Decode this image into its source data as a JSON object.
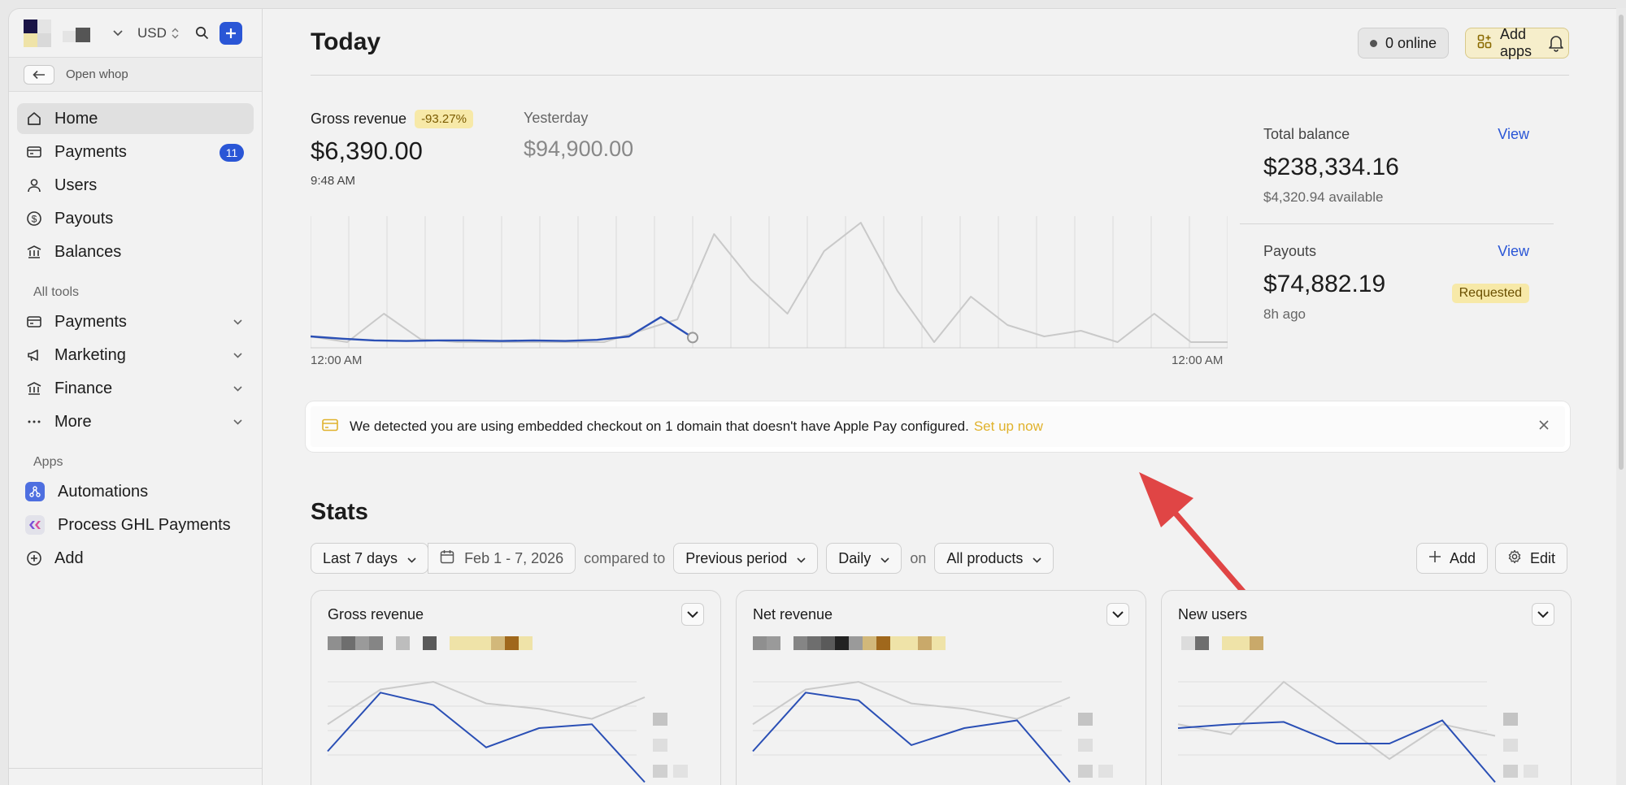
{
  "sidebar": {
    "currency": "USD",
    "open_whop": "Open whop",
    "nav": [
      {
        "label": "Home",
        "icon": "home-icon",
        "active": true
      },
      {
        "label": "Payments",
        "icon": "card-icon",
        "badge": "11"
      },
      {
        "label": "Users",
        "icon": "user-icon"
      },
      {
        "label": "Payouts",
        "icon": "dollar-circle-icon"
      },
      {
        "label": "Balances",
        "icon": "bank-icon"
      }
    ],
    "tools_label": "All tools",
    "tools": [
      {
        "label": "Payments",
        "icon": "card-icon"
      },
      {
        "label": "Marketing",
        "icon": "megaphone-icon"
      },
      {
        "label": "Finance",
        "icon": "bank-icon"
      },
      {
        "label": "More",
        "icon": "ellipsis-icon"
      }
    ],
    "apps_label": "Apps",
    "apps": [
      {
        "label": "Automations",
        "icon": "automations-icon"
      },
      {
        "label": "Process GHL Payments",
        "icon": "ghl-icon"
      },
      {
        "label": "Add",
        "icon": "plus-circle-icon"
      }
    ]
  },
  "header": {
    "title": "Today",
    "online": "0 online",
    "add_apps": "Add apps"
  },
  "revenue": {
    "label": "Gross revenue",
    "change": "-93.27%",
    "value": "$6,390.00",
    "time": "9:48 AM",
    "yesterday_label": "Yesterday",
    "yesterday_value": "$94,900.00",
    "x_start": "12:00 AM",
    "x_end": "12:00 AM"
  },
  "chart_data": {
    "type": "line",
    "x_labels": [
      "12:00 AM",
      "12:00 AM"
    ],
    "series": [
      {
        "color": "#2a4fb5",
        "values": [
          2,
          1.6,
          1.3,
          1.2,
          1.3,
          1.3,
          1.2,
          1.3,
          1.2,
          1.4,
          2.0,
          5.4,
          1.8
        ]
      },
      {
        "color": "#c9c9c9",
        "values": [
          2,
          1,
          6,
          1.5,
          1,
          1,
          1,
          1,
          1,
          3,
          5,
          20,
          12,
          6,
          17,
          22,
          10,
          1,
          9,
          4,
          2,
          3,
          1,
          6,
          1,
          1
        ]
      }
    ],
    "grid": true
  },
  "balances": {
    "total_label": "Total balance",
    "total_view": "View",
    "total_value": "$238,334.16",
    "total_sub": "$4,320.94 available",
    "payouts_label": "Payouts",
    "payouts_view": "View",
    "payouts_value": "$74,882.19",
    "payouts_status": "Requested",
    "payouts_sub": "8h ago"
  },
  "banner": {
    "text": "We detected you are using embedded checkout on 1 domain that doesn't have Apple Pay configured.",
    "link": "Set up now"
  },
  "stats": {
    "title": "Stats",
    "range": "Last 7 days",
    "dates": "Feb 1 - 7, 2026",
    "compared_to": "compared to",
    "period": "Previous period",
    "interval": "Daily",
    "on": "on",
    "products": "All products",
    "add": "Add",
    "edit": "Edit",
    "cards": [
      {
        "title": "Gross revenue"
      },
      {
        "title": "Net revenue"
      },
      {
        "title": "New users"
      }
    ]
  }
}
